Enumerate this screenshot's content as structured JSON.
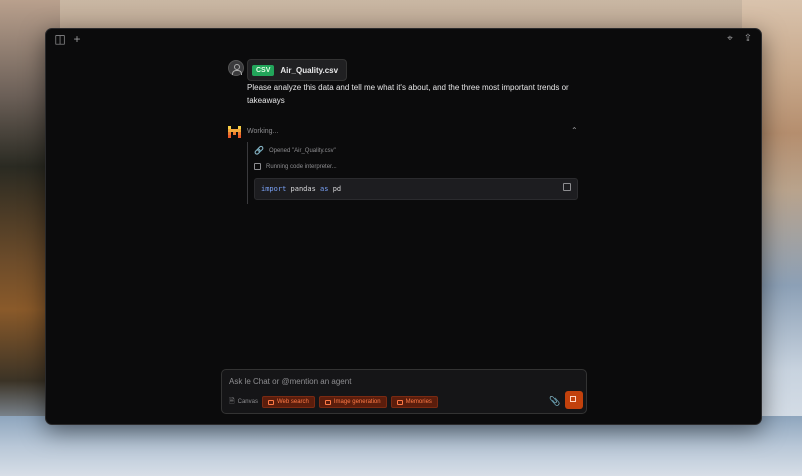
{
  "file": {
    "badge": "CSV",
    "name": "Air_Quality.csv"
  },
  "prompt": "Please analyze this data and tell me what it's about, and the three most important trends or takeaways",
  "agent": {
    "status": "Working...",
    "steps": [
      {
        "label": "Opened \"Air_Quality.csv\""
      },
      {
        "label": "Running code interpreter..."
      }
    ],
    "code": {
      "keyword_import": "import",
      "module": "pandas",
      "keyword_as": "as",
      "alias": "pd"
    }
  },
  "composer": {
    "placeholder": "Ask le Chat or @mention an agent",
    "tools": {
      "canvas": "Canvas",
      "web_search": "Web search",
      "image_generation": "Image generation",
      "memories": "Memories"
    }
  }
}
